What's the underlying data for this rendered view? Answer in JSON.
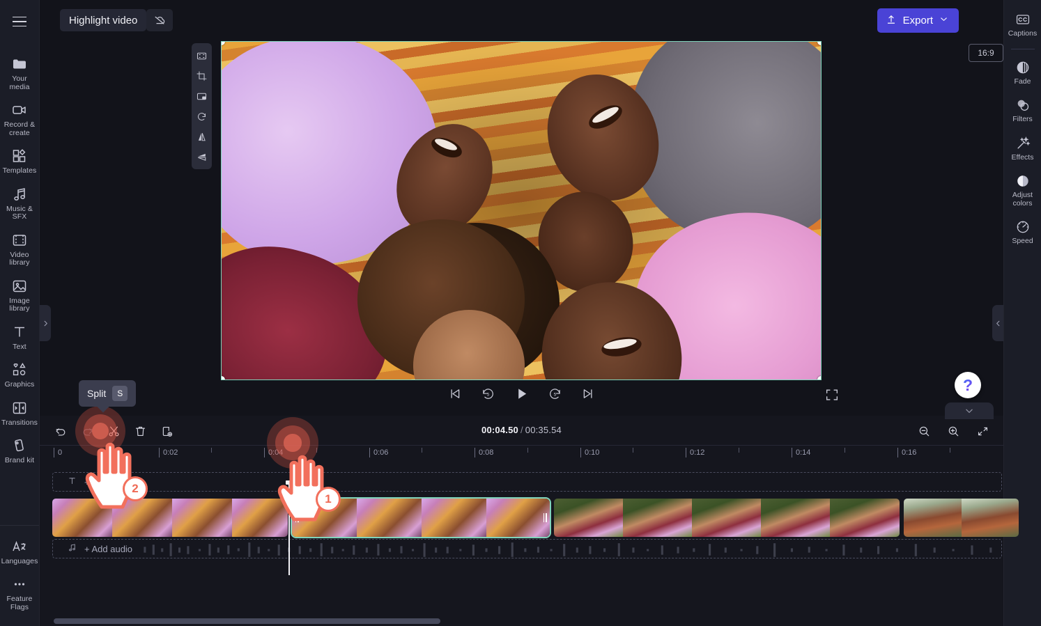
{
  "app": {
    "project_title": "Highlight video",
    "menu_icon": "hamburger-menu-icon",
    "cloud_icon": "cloud-off-icon",
    "export_label": "Export",
    "export_color": "#4a43d6"
  },
  "left_rail": {
    "items": [
      {
        "id": "your-media",
        "label": "Your media",
        "icon": "folder-icon"
      },
      {
        "id": "record-create",
        "label": "Record & create",
        "icon": "video-camera-icon"
      },
      {
        "id": "templates",
        "label": "Templates",
        "icon": "templates-icon"
      },
      {
        "id": "music-sfx",
        "label": "Music & SFX",
        "icon": "music-note-icon"
      },
      {
        "id": "video-library",
        "label": "Video library",
        "icon": "film-strip-icon"
      },
      {
        "id": "image-library",
        "label": "Image library",
        "icon": "image-icon"
      },
      {
        "id": "text",
        "label": "Text",
        "icon": "text-t-icon"
      },
      {
        "id": "graphics",
        "label": "Graphics",
        "icon": "shapes-icon"
      },
      {
        "id": "transitions",
        "label": "Transitions",
        "icon": "transitions-icon"
      },
      {
        "id": "brand-kit",
        "label": "Brand kit",
        "icon": "brand-kit-icon"
      }
    ],
    "bottom_items": [
      {
        "id": "languages",
        "label": "Languages",
        "icon": "translate-icon"
      },
      {
        "id": "feature-flags",
        "label": "Feature Flags",
        "icon": "ellipsis-icon"
      }
    ]
  },
  "right_rail": {
    "items": [
      {
        "id": "captions",
        "label": "Captions",
        "icon": "closed-captions-icon"
      },
      {
        "id": "fade",
        "label": "Fade",
        "icon": "fade-icon"
      },
      {
        "id": "filters",
        "label": "Filters",
        "icon": "filters-icon"
      },
      {
        "id": "effects",
        "label": "Effects",
        "icon": "magic-wand-icon"
      },
      {
        "id": "adjust-colors",
        "label": "Adjust colors",
        "icon": "contrast-circle-icon"
      },
      {
        "id": "speed",
        "label": "Speed",
        "icon": "speedometer-icon"
      }
    ]
  },
  "preview": {
    "aspect_ratio": "16:9",
    "selection_color": "#7fd4bb",
    "float_tools": [
      {
        "id": "fit",
        "icon": "fit-to-frame-icon"
      },
      {
        "id": "crop",
        "icon": "crop-icon"
      },
      {
        "id": "pip",
        "icon": "picture-in-picture-icon"
      },
      {
        "id": "rotate",
        "icon": "rotate-icon"
      },
      {
        "id": "flip-h",
        "icon": "flip-horizontal-icon"
      },
      {
        "id": "flip-v",
        "icon": "flip-vertical-icon"
      }
    ]
  },
  "player": {
    "controls": [
      {
        "id": "skip-start",
        "icon": "skip-to-start-icon"
      },
      {
        "id": "back-5",
        "icon": "rewind-5s-icon",
        "label": "5"
      },
      {
        "id": "play",
        "icon": "play-icon"
      },
      {
        "id": "forward-5",
        "icon": "forward-5s-icon",
        "label": "5"
      },
      {
        "id": "skip-end",
        "icon": "skip-to-end-icon"
      }
    ],
    "fullscreen_icon": "fullscreen-icon"
  },
  "timeline": {
    "toolbar": {
      "undo_icon": "undo-icon",
      "redo_icon": "redo-icon",
      "split_icon": "scissors-icon",
      "delete_icon": "trash-icon",
      "duplicate_icon": "duplicate-icon",
      "zoom_out_icon": "zoom-out-icon",
      "zoom_in_icon": "zoom-in-icon",
      "fit_icon": "fit-timeline-icon"
    },
    "current_time": "00:04.50",
    "total_time": "00:35.54",
    "time_separator": "/",
    "ruler_labels": [
      "0",
      "0:02",
      "0:04",
      "0:06",
      "0:08",
      "0:10",
      "0:12",
      "0:14",
      "0:16"
    ],
    "add_text_label": "+ Add text",
    "add_text_icon": "text-t-icon",
    "add_audio_label": "+ Add audio",
    "add_audio_icon": "music-note-icon",
    "playhead_time": "00:04.50",
    "clips": [
      {
        "id": "clip-1",
        "selected": false,
        "scene": "friends-lying-blanket"
      },
      {
        "id": "clip-2",
        "selected": true,
        "scene": "friends-lying-blanket"
      },
      {
        "id": "clip-3",
        "selected": false,
        "scene": "girls-outdoors-park"
      },
      {
        "id": "clip-4",
        "selected": false,
        "scene": "girl-jumping-bench"
      }
    ]
  },
  "annotations": {
    "split_tooltip_label": "Split",
    "split_tooltip_key": "S",
    "steps": [
      {
        "number": "1",
        "target": "timeline-ruler-playhead-position"
      },
      {
        "number": "2",
        "target": "split-button"
      }
    ],
    "accent_color": "#ef6a55"
  },
  "help": {
    "icon": "question-mark-icon"
  }
}
